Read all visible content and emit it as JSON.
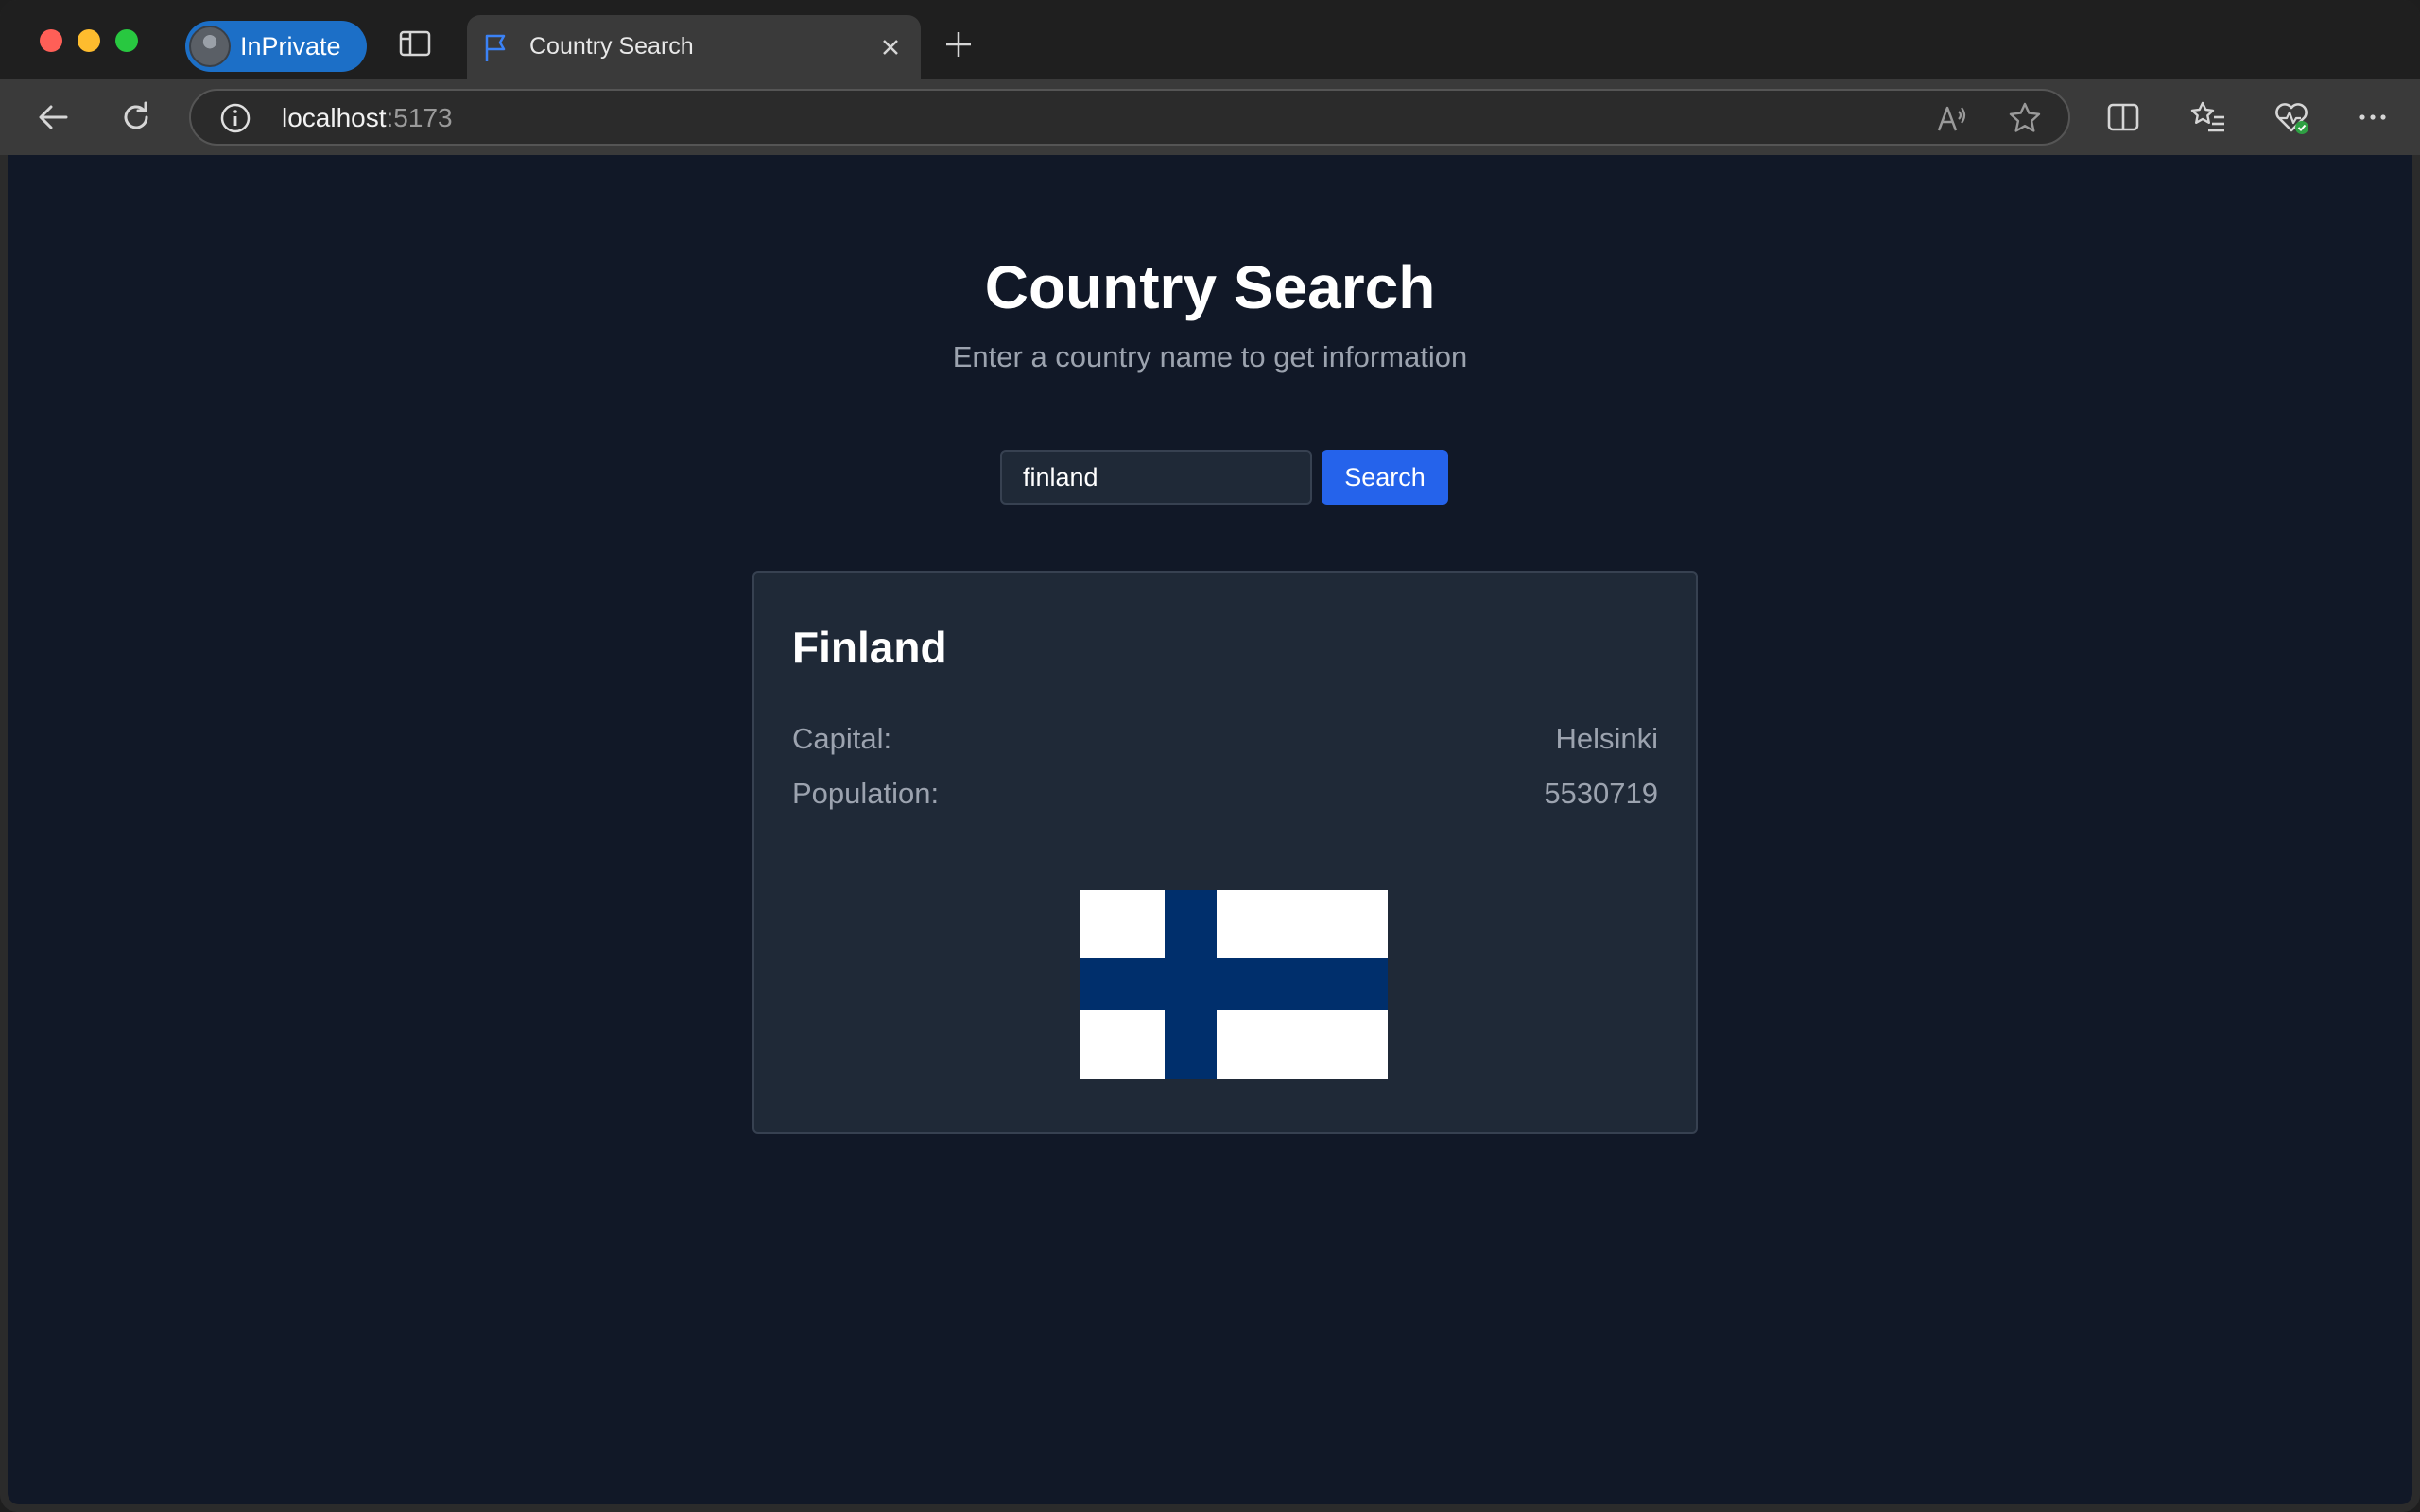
{
  "browser": {
    "profile_label": "InPrivate",
    "tab_title": "Country Search",
    "url_host": "localhost",
    "url_port": ":5173"
  },
  "page": {
    "title": "Country Search",
    "subtitle": "Enter a country name to get information",
    "search": {
      "value": "finland",
      "button_label": "Search"
    },
    "result": {
      "country_name": "Finland",
      "capital_label": "Capital:",
      "capital_value": "Helsinki",
      "population_label": "Population:",
      "population_value": "5530719",
      "flag_icon": "finland-flag",
      "flag_colors": {
        "background": "#ffffff",
        "cross": "#002f6c"
      }
    }
  },
  "colors": {
    "page_background": "#111827",
    "card_background": "#1f2937",
    "accent": "#2563eb",
    "muted_text": "#9ca3af"
  }
}
